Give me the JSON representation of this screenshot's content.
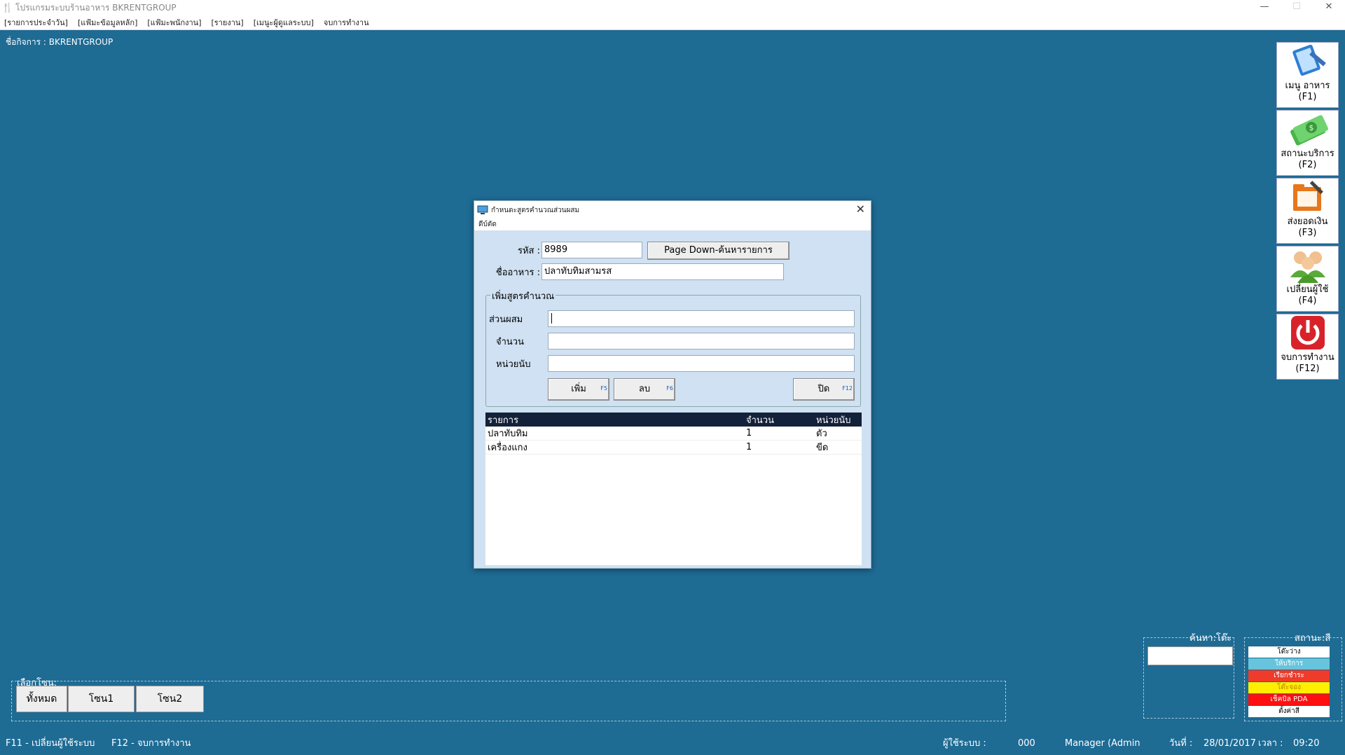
{
  "window": {
    "title": "โปรแกรมระบบร้านอาหาร  BKRENTGROUP",
    "minimize": "—",
    "maximize": "☐",
    "close": "✕"
  },
  "menu": [
    "[รายการประจำวัน]",
    "[แฟ้มะข้อมูลหลัก]",
    "[แฟ้มะพนักงาน]",
    "[รายงาน]",
    "[เมนูะผู้ดูแลระบบ]",
    "จบการทำงาน"
  ],
  "business": "ชื่อกิจการ :  BKRENTGROUP",
  "side_buttons": [
    {
      "label": "เมนู อาหาร",
      "key": "(F1)",
      "icon": "book-pencil-icon"
    },
    {
      "label": "สถานะบริการ",
      "key": "(F2)",
      "icon": "money-icon"
    },
    {
      "label": "ส่งยอดเงิน",
      "key": "(F3)",
      "icon": "folder-edit-icon"
    },
    {
      "label": "เปลี่ยนผู้ใช้",
      "key": "(F4)",
      "icon": "users-icon"
    },
    {
      "label": "จบการทำงาน",
      "key": "(F12)",
      "icon": "power-icon"
    }
  ],
  "dialog": {
    "title": "กำหนดะสูตรคำนวณส่วนผสม",
    "menu": "ดีบ์ตัด",
    "code_label": "รหัส :",
    "code_value": "8989",
    "search_button": "Page Down-ค้นหารายการ",
    "name_label": "ชื่ออาหาร :",
    "name_value": "ปลาทับทิมสามรส",
    "group_title": "เพิ่มสูตรคำนวณ",
    "ingredient_label": "ส่วนผสม",
    "ingredient_value": "",
    "qty_label": "จำนวน",
    "qty_value": "",
    "unit_label": "หน่วยนับ",
    "unit_value": "",
    "add_button": "เพิ่ม",
    "add_key": "F5",
    "delete_button": "ลบ",
    "delete_key": "F6",
    "close_button": "ปิด",
    "close_key": "F12",
    "columns": [
      "รายการ",
      "จำนวน",
      "หน่วยนับ"
    ],
    "rows": [
      [
        "ปลาทับทิม",
        "1",
        "ตัว"
      ],
      [
        "เครื่องแกง",
        "1",
        "ขีด"
      ]
    ]
  },
  "zone": {
    "label": "เลือกโซน:",
    "buttons": [
      "ทั้งหมด",
      "โซน1",
      "โซน2"
    ]
  },
  "table_search": {
    "label": "ค้นหา:โต๊ะ",
    "value": ""
  },
  "status": {
    "label": "สถานะ:สี",
    "items": [
      {
        "text": "โต๊ะว่าง",
        "bg": "#ffffff",
        "color": "#000000"
      },
      {
        "text": "ให้บริการ",
        "bg": "#66c5dc",
        "color": "#ffffff"
      },
      {
        "text": "เรียกชำระ",
        "bg": "#ee3b2b",
        "color": "#ffffff"
      },
      {
        "text": "โต๊ะจอง",
        "bg": "#ffee00",
        "color": "#c08000"
      },
      {
        "text": "เช็คบิล PDA",
        "bg": "#ff1010",
        "color": "#ffffff"
      },
      {
        "text": "ตั้งค่าสี",
        "bg": "#ffffff",
        "color": "#000000"
      }
    ]
  },
  "statusbar": {
    "f11": "F11 - เปลี่ยนผู้ใช้ระบบ",
    "f12": "F12 - จบการทำงาน",
    "user_label": "ผู้ใช้ระบบ :",
    "user_code": "000",
    "user_name": "Manager (Admin",
    "date_label": "วันที่ :",
    "date": "28/01/2017",
    "time_label": "เวลา :",
    "time": "09:20"
  }
}
